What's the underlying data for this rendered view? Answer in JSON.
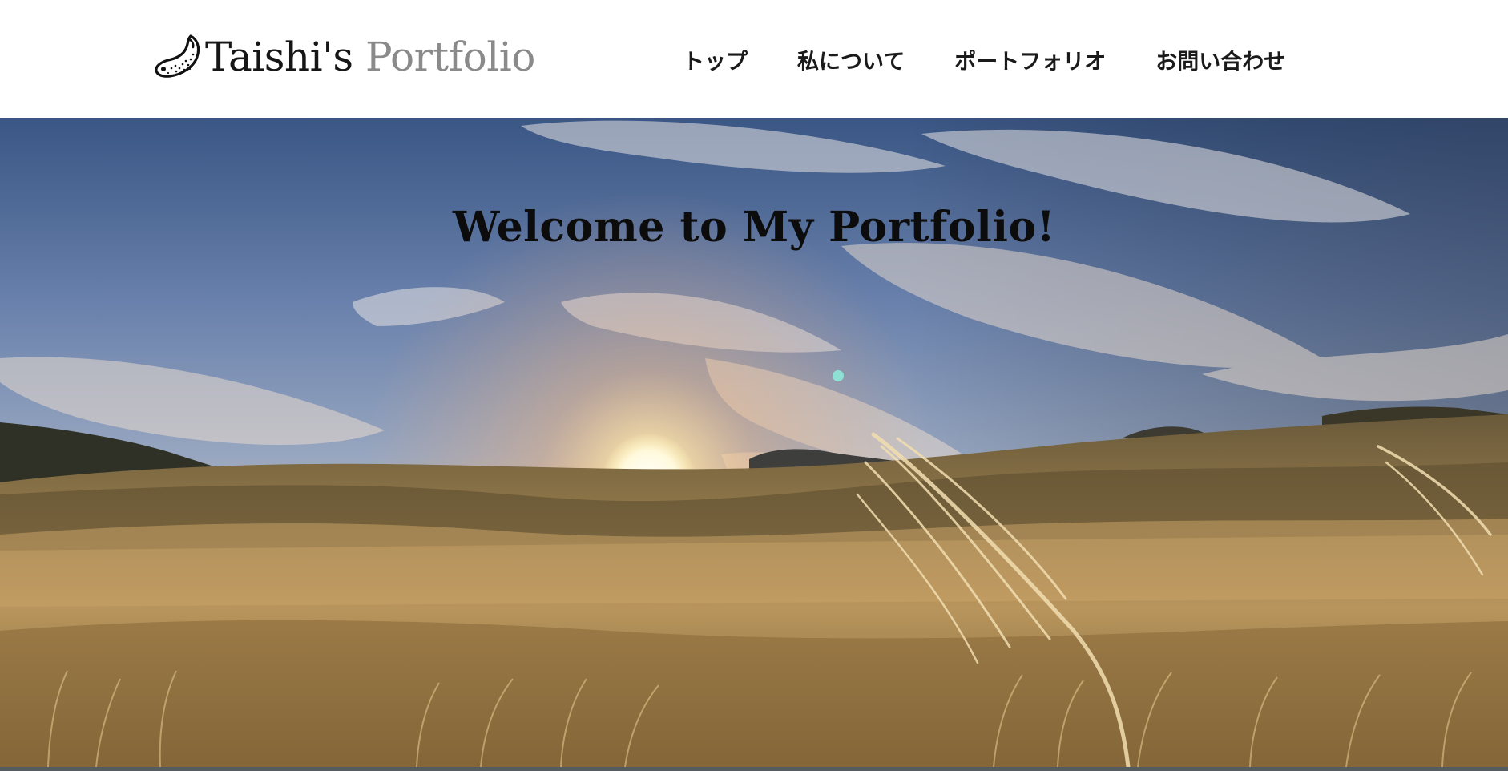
{
  "header": {
    "logo": {
      "icon": "tadpole-icon",
      "main_text": "Taishi's",
      "sub_text": "Portfolio"
    },
    "nav": [
      {
        "label": "トップ"
      },
      {
        "label": "私について"
      },
      {
        "label": "ポートフォリオ"
      },
      {
        "label": "お問い合わせ"
      }
    ]
  },
  "hero": {
    "title": "Welcome to My Portfolio!",
    "image": "sunset-over-pampas-grass-field"
  },
  "colors": {
    "header_bg": "#ffffff",
    "logo_main": "#161616",
    "logo_sub": "#8a8a8a",
    "nav_text": "#1a1a1a",
    "hero_title": "#0c0c0c"
  }
}
